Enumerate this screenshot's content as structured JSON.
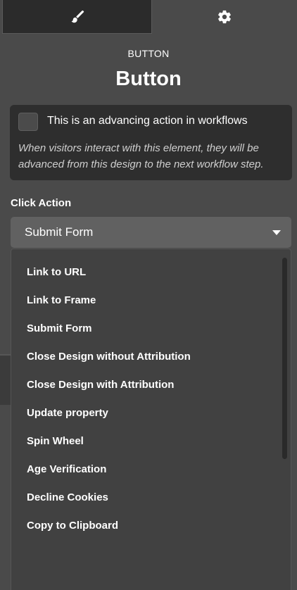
{
  "tabs": {
    "style_icon": "paintbrush-icon",
    "settings_icon": "gear-icon"
  },
  "header": {
    "kind": "BUTTON",
    "title": "Button"
  },
  "advancing": {
    "checked": false,
    "label": "This is an advancing action in workflows",
    "help": "When visitors interact with this element, they will be advanced from this design to the next workflow step."
  },
  "click_action": {
    "label": "Click Action",
    "selected": "Submit Form",
    "options": [
      "Link to URL",
      "Link to Frame",
      "Submit Form",
      "Close Design without Attribution",
      "Close Design with Attribution",
      "Update property",
      "Spin Wheel",
      "Age Verification",
      "Decline Cookies",
      "Copy to Clipboard"
    ]
  },
  "colors": {
    "panel_bg": "#4a4a4a",
    "active_tab_bg": "#2b2b2b",
    "box_bg": "#2e2e2e",
    "select_bg": "#616161",
    "menu_bg": "#414141"
  }
}
